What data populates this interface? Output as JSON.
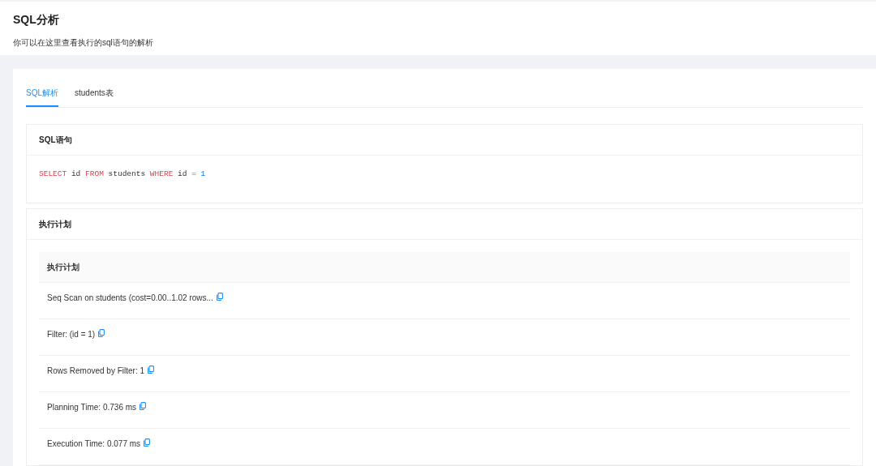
{
  "page": {
    "title": "SQL分析",
    "subtitle": "你可以在这里查看执行的sql语句的解析"
  },
  "tabs": [
    {
      "label": "SQL解析",
      "selected": true
    },
    {
      "label": "students表",
      "selected": false
    }
  ],
  "sql_card": {
    "title": "SQL语句",
    "tokens": [
      {
        "kind": "keyword",
        "text": "SELECT"
      },
      {
        "kind": "ident",
        "text": "id"
      },
      {
        "kind": "keyword",
        "text": "FROM"
      },
      {
        "kind": "ident",
        "text": "students"
      },
      {
        "kind": "keyword",
        "text": "WHERE"
      },
      {
        "kind": "ident",
        "text": "id"
      },
      {
        "kind": "operator",
        "text": "="
      },
      {
        "kind": "number",
        "text": "1"
      }
    ]
  },
  "plan_card": {
    "title": "执行计划",
    "table": {
      "columns": [
        "执行计划"
      ],
      "rows": [
        "Seq Scan on students (cost=0.00..1.02 rows...",
        "Filter: (id = 1)",
        "Rows Removed by Filter: 1",
        "Planning Time: 0.736 ms",
        "Execution Time: 0.077 ms"
      ]
    }
  }
}
